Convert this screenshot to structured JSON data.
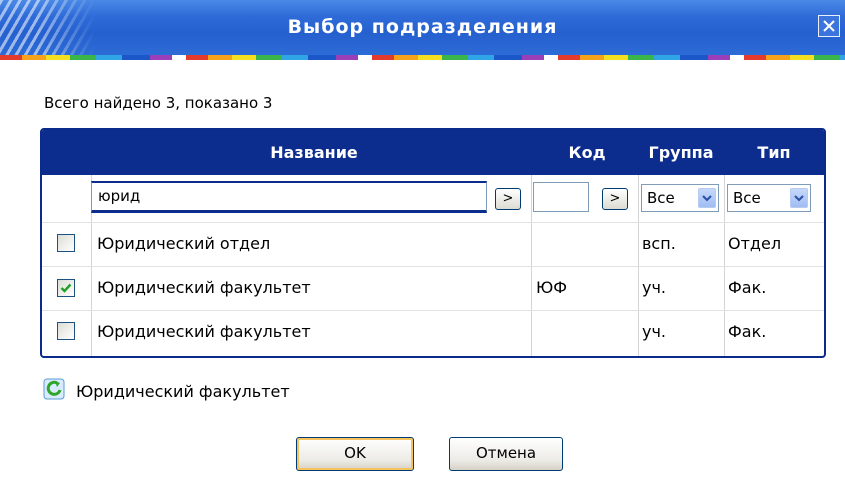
{
  "window": {
    "title": "Выбор подразделения"
  },
  "summary": "Всего найдено 3, показано 3",
  "table": {
    "columns": [
      "Название",
      "Код",
      "Группа",
      "Тип"
    ],
    "filter": {
      "name_value": "юрид",
      "code_value": "",
      "go_label": ">",
      "group_selected": "Все",
      "type_selected": "Все"
    },
    "rows": [
      {
        "checked": false,
        "name": "Юридический отдел",
        "code": "",
        "group": "всп.",
        "type": "Отдел"
      },
      {
        "checked": true,
        "name": "Юридический факультет",
        "code": "ЮФ",
        "group": "уч.",
        "type": "Фак."
      },
      {
        "checked": false,
        "name": "Юридический факультет",
        "code": "",
        "group": "уч.",
        "type": "Фак."
      }
    ]
  },
  "selection": {
    "label": "Юридический факультет",
    "icon": "refresh-icon"
  },
  "buttons": {
    "ok": "OK",
    "cancel": "Отмена"
  },
  "colors": {
    "title_bar": "#2560cf",
    "table_header": "#0c2c8e",
    "check": "#21a121"
  }
}
